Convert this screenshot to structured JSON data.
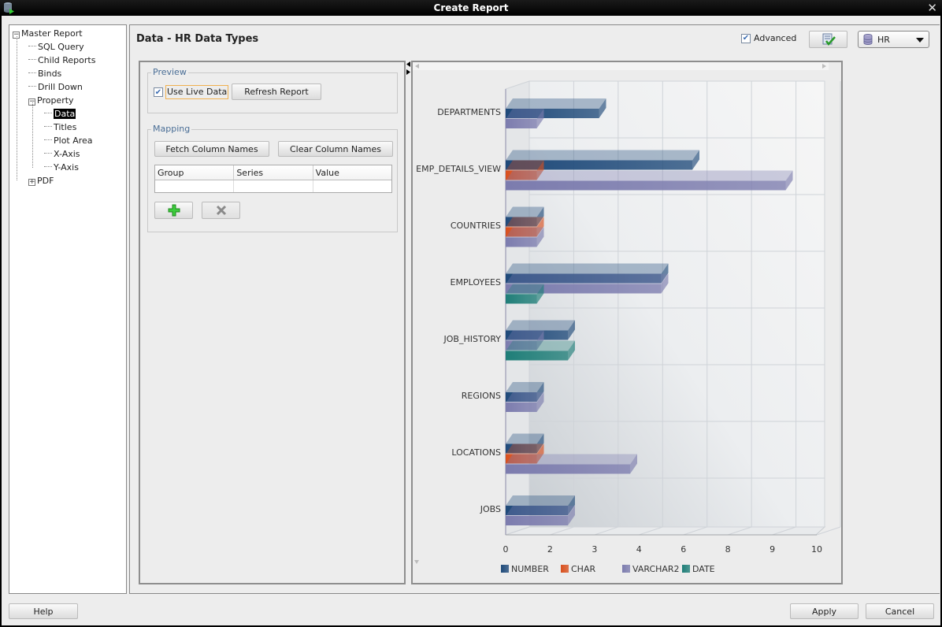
{
  "window": {
    "title": "Create Report"
  },
  "tree": {
    "items": [
      {
        "label": "Master Report",
        "level": 0,
        "expander": "minus"
      },
      {
        "label": "SQL Query",
        "level": 1
      },
      {
        "label": "Child Reports",
        "level": 1
      },
      {
        "label": "Binds",
        "level": 1
      },
      {
        "label": "Drill Down",
        "level": 1
      },
      {
        "label": "Property",
        "level": 1,
        "expander": "minus"
      },
      {
        "label": "Data",
        "level": 2,
        "selected": true
      },
      {
        "label": "Titles",
        "level": 2
      },
      {
        "label": "Plot Area",
        "level": 2
      },
      {
        "label": "X-Axis",
        "level": 2
      },
      {
        "label": "Y-Axis",
        "level": 2
      },
      {
        "label": "PDF",
        "level": 1,
        "expander": "plus"
      }
    ]
  },
  "header": {
    "title": "Data - HR Data Types",
    "advanced_label": "Advanced",
    "advanced_checked": true,
    "test_button_icon": "test-query-icon",
    "datasource": {
      "selected": "HR",
      "icon": "database-icon"
    }
  },
  "preview": {
    "group_label": "Preview",
    "use_live_data_label": "Use Live Data",
    "use_live_data_checked": true,
    "refresh_label": "Refresh Report"
  },
  "mapping": {
    "group_label": "Mapping",
    "fetch_label": "Fetch Column Names",
    "clear_label": "Clear Column Names",
    "columns": [
      "Group",
      "Series",
      "Value"
    ],
    "rows": [],
    "add_icon": "add-icon",
    "delete_icon": "delete-icon"
  },
  "footer": {
    "help_label": "Help",
    "apply_label": "Apply",
    "cancel_label": "Cancel"
  },
  "chart_data": {
    "type": "bar",
    "orientation": "horizontal",
    "style": "3d",
    "title": "",
    "xlabel": "",
    "ylabel": "",
    "categories": [
      "DEPARTMENTS",
      "EMP_DETAILS_VIEW",
      "COUNTRIES",
      "EMPLOYEES",
      "JOB_HISTORY",
      "REGIONS",
      "LOCATIONS",
      "JOBS"
    ],
    "series": [
      {
        "name": "NUMBER",
        "color": "#1f4a7a",
        "values": [
          3,
          6,
          1,
          5,
          2,
          1,
          1,
          2
        ]
      },
      {
        "name": "CHAR",
        "color": "#d9501e",
        "values": [
          0,
          1,
          1,
          0,
          0,
          0,
          1,
          0
        ]
      },
      {
        "name": "VARCHAR2",
        "color": "#7c7cae",
        "values": [
          1,
          9,
          1,
          5,
          1,
          1,
          4,
          2
        ]
      },
      {
        "name": "DATE",
        "color": "#1f7e78",
        "values": [
          0,
          0,
          0,
          1,
          2,
          0,
          0,
          0
        ]
      }
    ],
    "x_ticks": [
      "0",
      "2",
      "3",
      "4",
      "6",
      "8",
      "9",
      "10"
    ],
    "xlim": [
      0,
      10
    ],
    "grid": true,
    "legend": "bottom"
  }
}
